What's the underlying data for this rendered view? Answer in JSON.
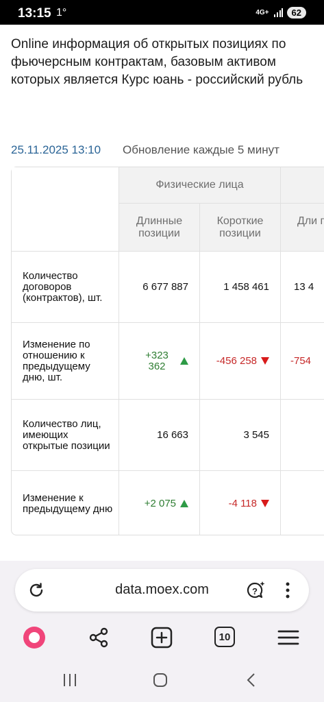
{
  "status_bar": {
    "time": "13:15",
    "temp": "1°",
    "network": "4G+",
    "battery": "62"
  },
  "page": {
    "heading": "Online информация об открытых позициях по фьючерсным контрактам, базовым активом которых является Курс юань - российский рубль",
    "date": "25.11.2025 13:10",
    "update_note": "Обновление каждые 5 минут"
  },
  "table": {
    "group_header": "Физические лица",
    "col_long": "Длинные позиции",
    "col_short": "Короткие позиции",
    "col_next": "Дли по",
    "rows": [
      {
        "label": "Количество договоров (контрактов), шт.",
        "long": "6 677 887",
        "short": "1 458 461",
        "next": "13 4"
      },
      {
        "label": "Изменение по отношению к предыдущему дню, шт.",
        "long": "+323 362",
        "short": "-456 258",
        "next": "-754"
      },
      {
        "label": "Количество лиц, имеющих открытые позиции",
        "long": "16 663",
        "short": "3 545",
        "next": ""
      },
      {
        "label": "Изменение к предыдущему дню",
        "long": "+2 075",
        "short": "-4 118",
        "next": ""
      }
    ]
  },
  "browser": {
    "url": "data.moex.com",
    "tabs_count": "10"
  },
  "colors": {
    "positive": "#2e7d32",
    "negative": "#c62828",
    "date_blue": "#2a6496",
    "alice_pink": "#f0457a"
  }
}
